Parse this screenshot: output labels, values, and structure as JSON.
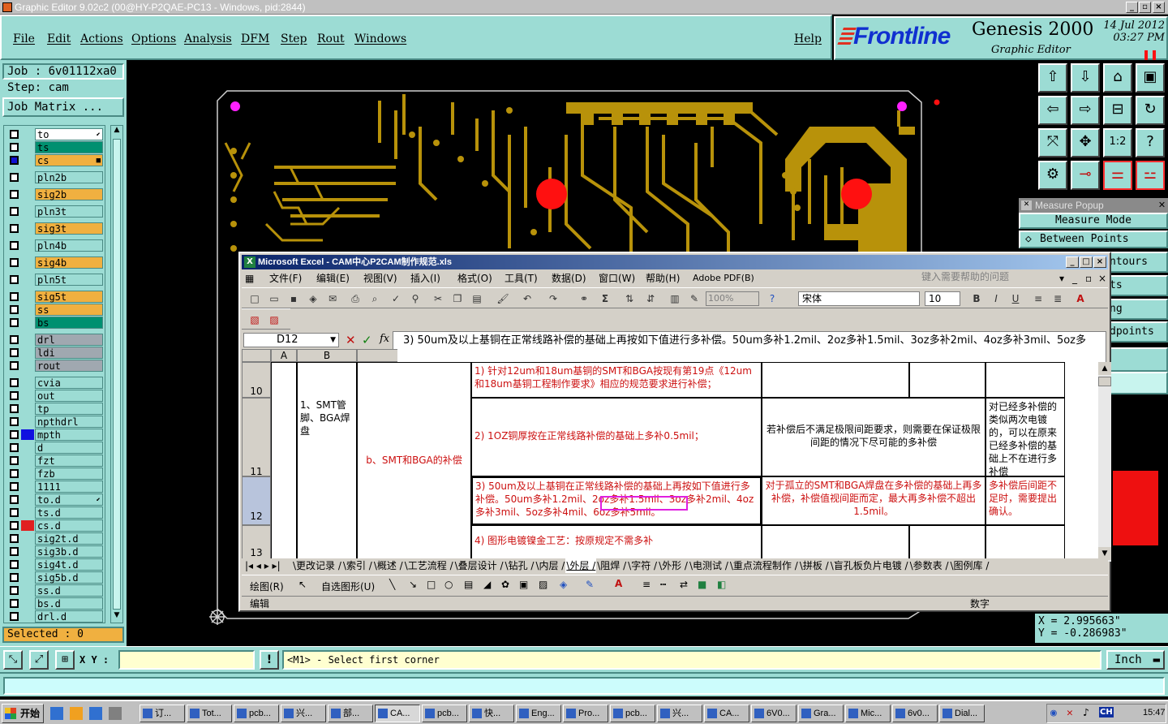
{
  "genesis": {
    "window_title": "Graphic Editor 9.02c2 (00@HY-P2QAE-PC13 - Windows, pid:2844)",
    "menu": [
      "File",
      "Edit",
      "Actions",
      "Options",
      "Analysis",
      "DFM",
      "Step",
      "Rout",
      "Windows"
    ],
    "help": "Help",
    "brand": "Frontline",
    "product": "Genesis 2000",
    "subtitle": "Graphic Editor",
    "date": "14 Jul 2012",
    "time": "03:27 PM",
    "job_label": "Job : 6v01112xa0",
    "step_label": "Step: cam",
    "job_matrix": "Job Matrix ...",
    "selected": "Selected : 0",
    "layers": [
      {
        "name": "to",
        "color": "#ffffff",
        "marker": "⬋",
        "box": "#ffffff"
      },
      {
        "name": "ts",
        "color": "#009070",
        "box": "#009070"
      },
      {
        "name": "cs",
        "color": "#f0b040",
        "box": "#f0b040",
        "on": true,
        "marker": "■"
      },
      {
        "name": "pln2b",
        "color": "#9cdcd4",
        "box": "#9cdcd4"
      },
      {
        "name": "sig2b",
        "color": "#f0b040",
        "box": "#f0b040"
      },
      {
        "name": "pln3t",
        "color": "#9cdcd4",
        "box": "#9cdcd4"
      },
      {
        "name": "sig3t",
        "color": "#f0b040",
        "box": "#f0b040"
      },
      {
        "name": "pln4b",
        "color": "#9cdcd4",
        "box": "#9cdcd4"
      },
      {
        "name": "sig4b",
        "color": "#f0b040",
        "box": "#f0b040"
      },
      {
        "name": "pln5t",
        "color": "#9cdcd4",
        "box": "#9cdcd4"
      },
      {
        "name": "sig5t",
        "color": "#f0b040",
        "box": "#f0b040"
      },
      {
        "name": "ss",
        "color": "#f0b040",
        "box": "#f0b040"
      },
      {
        "name": "bs",
        "color": "#009070",
        "box": "#009070"
      },
      {
        "name": "drl",
        "color": "#a0a8b0",
        "box": "#a0a8b0"
      },
      {
        "name": "ldi",
        "color": "#a0a8b0",
        "box": "#a0a8b0"
      },
      {
        "name": "rout",
        "color": "#a0a8b0",
        "box": "#a0a8b0"
      },
      {
        "name": "cvia",
        "color": "#9cdcd4",
        "box": "#9cdcd4"
      },
      {
        "name": "out",
        "color": "#9cdcd4",
        "box": "#9cdcd4"
      },
      {
        "name": "tp",
        "color": "#9cdcd4",
        "box": "#9cdcd4"
      },
      {
        "name": "npthdrl",
        "color": "#9cdcd4",
        "box": "#9cdcd4"
      },
      {
        "name": "mpth",
        "color": "#9cdcd4",
        "box": "#9cdcd4",
        "swatch": "#1010e0"
      },
      {
        "name": "d",
        "color": "#9cdcd4",
        "box": "#9cdcd4"
      },
      {
        "name": "fzt",
        "color": "#9cdcd4",
        "box": "#9cdcd4"
      },
      {
        "name": "fzb",
        "color": "#9cdcd4",
        "box": "#9cdcd4"
      },
      {
        "name": "1111",
        "color": "#9cdcd4",
        "box": "#9cdcd4"
      },
      {
        "name": "to.d",
        "color": "#9cdcd4",
        "box": "#9cdcd4",
        "marker": "⬋"
      },
      {
        "name": "ts.d",
        "color": "#9cdcd4",
        "box": "#9cdcd4"
      },
      {
        "name": "cs.d",
        "color": "#9cdcd4",
        "box": "#9cdcd4",
        "swatch": "#e02020"
      },
      {
        "name": "sig2t.d",
        "color": "#9cdcd4",
        "box": "#9cdcd4"
      },
      {
        "name": "sig3b.d",
        "color": "#9cdcd4",
        "box": "#9cdcd4"
      },
      {
        "name": "sig4t.d",
        "color": "#9cdcd4",
        "box": "#9cdcd4"
      },
      {
        "name": "sig5b.d",
        "color": "#9cdcd4",
        "box": "#9cdcd4"
      },
      {
        "name": "ss.d",
        "color": "#9cdcd4",
        "box": "#9cdcd4"
      },
      {
        "name": "bs.d",
        "color": "#9cdcd4",
        "box": "#9cdcd4"
      },
      {
        "name": "drl.d",
        "color": "#9cdcd4",
        "box": "#9cdcd4"
      }
    ],
    "measure_popup": {
      "title": "Measure Popup",
      "mode_label": "Measure Mode",
      "between": "Between Points",
      "partial": [
        "ntours",
        "ts",
        "ng",
        "dpoints"
      ]
    },
    "coords": {
      "x": "X = 2.995663\"",
      "y": "Y = -0.286983\""
    },
    "xy_label": "X Y :",
    "xy_value": "",
    "prompt": "<M1> - Select first corner",
    "units": "Inch",
    "colors": {
      "panel": "#9cdcd4",
      "copper": "#b8920a",
      "pad": "#ff1010",
      "magenta": "#ff20ff",
      "selected": "#f0b040"
    }
  },
  "excel": {
    "title": "Microsoft Excel - CAM中心P2CAM制作规范.xls",
    "menu": [
      "文件(F)",
      "编辑(E)",
      "视图(V)",
      "插入(I)",
      "格式(O)",
      "工具(T)",
      "数据(D)",
      "窗口(W)",
      "帮助(H)",
      "Adobe PDF(B)"
    ],
    "help_placeholder": "键入需要帮助的问题",
    "zoom": "100%",
    "font": "宋体",
    "font_size": "10",
    "name_box": "D12",
    "formula": "3) 50um及以上基铜在正常线路补偿的基础上再按如下值进行多补偿。50um多补1.2mil、2oz多补1.5mil、3oz多补2mil、4oz多补3mil、5oz多补4mil、6oz多补5mil。",
    "columns": [
      "A",
      "B"
    ],
    "rows": [
      "10",
      "11",
      "12",
      "13"
    ],
    "cell_b": "1、SMT管脚、BGA焊盘",
    "cell_c": "b、SMT和BGA的补偿",
    "d10": "1) 针对12um和18um基铜的SMT和BGA按现有第19点《12um和18um基铜工程制作要求》相应的规范要求进行补偿；",
    "d11": "2) 1OZ铜厚按在正常线路补偿的基础上多补0.5mil；",
    "e11": "若补偿后不满足极限间距要求，则需要在保证极限间距的情况下尽可能的多补偿",
    "g11": "对已经多补偿的类似两次电镀的，可以在原来已经多补偿的基础上不在进行多补偿",
    "d12": "3) 50um及以上基铜在正常线路补偿的基础上再按如下值进行多补偿。50um多补1.2mil、2oz多补1.5mil、3oz多补2mil、4oz多补3mil、5oz多补4mil、6oz多补5mil。",
    "e12": "对于孤立的SMT和BGA焊盘在多补偿的基础上再多补偿，补偿值视间距而定，最大再多补偿不超出1.5mil。",
    "g12": "多补偿后间距不足时，需要提出确认。",
    "d13": "4) 图形电镀镍金工艺：按原规定不需多补",
    "sheet_tabs": [
      "更改记录",
      "索引",
      "概述",
      "工艺流程",
      "叠层设计",
      "钻孔",
      "内层",
      "外层",
      "阻焊",
      "字符",
      "外形",
      "电测试",
      "重点流程制作",
      "拼板",
      "盲孔板负片电镀",
      "参数表",
      "图例库"
    ],
    "draw_label": "绘图(R)",
    "autoshape": "自选图形(U)",
    "status_left": "编辑",
    "status_right": "数字"
  },
  "taskbar": {
    "start": "开始",
    "items": [
      "订...",
      "Tot...",
      "pcb...",
      "兴...",
      "部...",
      "CA...",
      "pcb...",
      "快...",
      "Eng...",
      "Pro...",
      "pcb...",
      "兴...",
      "CA...",
      "6V0...",
      "Gra...",
      "Mic...",
      "6v0...",
      "Dial..."
    ],
    "clock": "15:47"
  }
}
